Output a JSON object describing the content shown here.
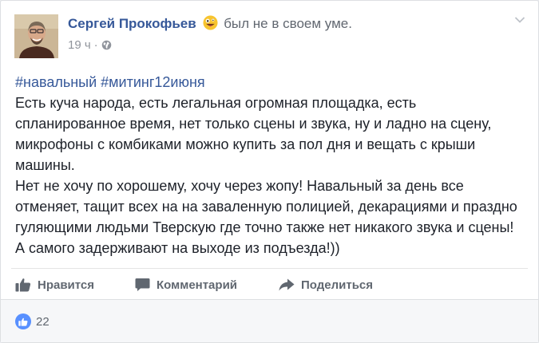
{
  "post": {
    "author": "Сергей Прокофьев",
    "feeling": "был не в своем уме.",
    "feeling_icon": "crazy-face-emoji",
    "time": "19 ч",
    "separator": "·",
    "privacy_icon": "globe-icon",
    "hashtags": [
      "#навальный",
      "#митинг12июня"
    ],
    "paragraphs": [
      "Есть куча народа, есть легальная огромная площадка, есть спланированное время, нет только сцены и звука, ну и ладно на сцену, микрофоны с комбиками можно купить за пол дня и вещать с крыши машины.",
      "Нет не хочу по хорошему, хочу через жопу! Навальный за день все отменяет, тащит всех на на заваленную полицией, декарациями и праздно гуляющими людьми Тверскую где точно также нет никакого звука и сцены! А самого задерживают на выходе из подъезда!))"
    ]
  },
  "actions": {
    "like": "Нравится",
    "comment": "Комментарий",
    "share": "Поделиться"
  },
  "reactions": {
    "count": "22"
  },
  "colors": {
    "link": "#365899",
    "muted": "#90949c",
    "like_badge": "#5890ff"
  }
}
